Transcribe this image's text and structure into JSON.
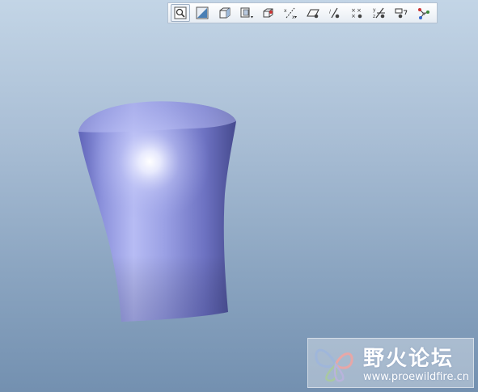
{
  "toolbar": {
    "buttons": [
      {
        "icon": "zoom-refit-icon"
      },
      {
        "icon": "repaint-icon"
      },
      {
        "icon": "shaded-view-icon"
      },
      {
        "icon": "saved-views-icon"
      },
      {
        "icon": "spin-center-icon"
      },
      {
        "icon": "datum-axis-display-icon"
      },
      {
        "icon": "datum-plane-display-icon"
      },
      {
        "icon": "axis-display-icon"
      },
      {
        "icon": "point-display-icon"
      },
      {
        "icon": "csys-display-icon"
      },
      {
        "icon": "annotation-display-icon"
      },
      {
        "icon": "model-tree-network-icon"
      }
    ]
  },
  "viewport": {
    "background_top": "#c3d5e6",
    "background_bottom": "#7390b0",
    "model_color": "#9aa0e2"
  },
  "watermark": {
    "title": "野火论坛",
    "url": "www.proewildfire.cn"
  }
}
